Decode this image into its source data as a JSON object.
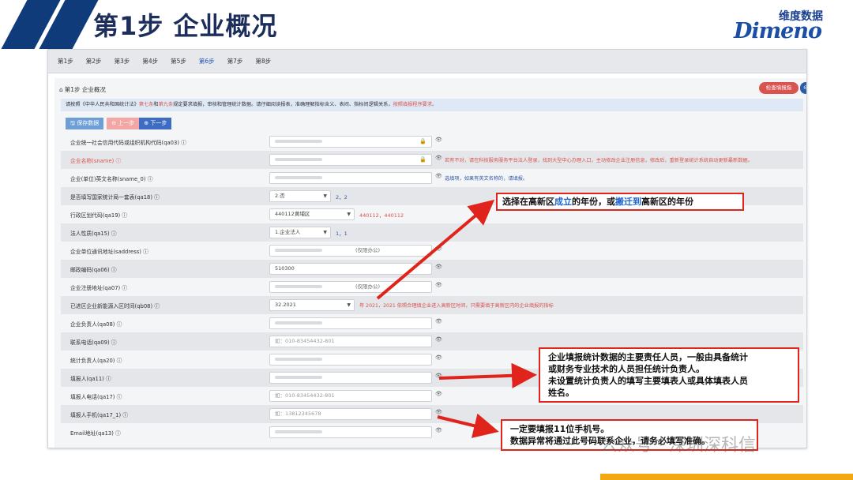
{
  "slide": {
    "title": "第1步  企业概况"
  },
  "logo": {
    "cn": "维度数据",
    "en": "Dimeno"
  },
  "steps": [
    "第1步",
    "第2步",
    "第3步",
    "第4步",
    "第5步",
    "第6步",
    "第7步",
    "第8步"
  ],
  "card": {
    "title": "第1步 企业概况",
    "check_button": "检查填报指",
    "more_button": "⊖",
    "notice_parts": [
      {
        "text": "请按照《中华人民共和国统计法》",
        "red": false
      },
      {
        "text": "第七条",
        "red": true
      },
      {
        "text": "和",
        "red": false
      },
      {
        "text": "第九条",
        "red": true
      },
      {
        "text": "规定要求填报，审核和管理统计数据。请仔细阅读报表，准确理解指标含义、表间、指标间逻辑关系，",
        "red": false
      },
      {
        "text": "按照填报程序要求。",
        "red": true
      }
    ],
    "save_button": "保存数据",
    "prev_button": "上一步",
    "next_button": "下一步"
  },
  "rows": [
    {
      "label": "企业统一社会信用代码或组织机构代码(qa03)",
      "value": "",
      "placeholder": "",
      "lock": true
    },
    {
      "label": "企业名称(sname)",
      "label_red": true,
      "value": "",
      "placeholder": "",
      "lock": true,
      "note": "若有不对，请在科技服务服务平台法人登录，找到大型中心办理入口，主动修改企业注册信息，修改后，重新登录统计系统自动更新最新数据。"
    },
    {
      "label": "企业(单位)英文名称(sname_0)",
      "value": "",
      "placeholder": "",
      "note": "选填项，如果有英文名称的，请填报。",
      "note_blue": true
    },
    {
      "label": "是否填写国家统计局一套表(qa18)",
      "value": "2.否",
      "select": true,
      "after": "2，2"
    },
    {
      "label": "行政区划代码(qa19)",
      "value": "440112黄埔区",
      "select": true,
      "val_note": "440112，440112"
    },
    {
      "label": "法人性质(qa15)",
      "value": "1.企业法人",
      "select": true,
      "after": "1，1"
    },
    {
      "label": "企业单位通讯地址(saddress)",
      "value": "",
      "placeholder": "",
      "suffix": "(仅限办公)"
    },
    {
      "label": "邮政编码(qa06)",
      "value": "510300",
      "placeholder": ""
    },
    {
      "label": "企业注册地址(qa07)",
      "value": "",
      "placeholder": "",
      "suffix": "(仅限办公)"
    },
    {
      "label": "已进区企业新能源入区时间(qb08)",
      "value": "32.2021",
      "select": true,
      "note": "年 2021，2021 依照合理填企业进入高新区时间，只需要填于高新区内的企业填报的指标"
    },
    {
      "label": "企业负责人(qa08)",
      "value": "",
      "placeholder": ""
    },
    {
      "label": "联系电话(qa09)",
      "value": "",
      "placeholder": "如：010-83454432-801"
    },
    {
      "label": "统计负责人(qa20)",
      "value": "",
      "placeholder": ""
    },
    {
      "label": "填报人(qa11)",
      "value": "",
      "placeholder": ""
    },
    {
      "label": "填报人电话(qa17)",
      "value": "",
      "placeholder": "如：010-83454432-801"
    },
    {
      "label": "填报人手机(qa17_1)",
      "value": "",
      "placeholder": "如：13812345678"
    },
    {
      "label": "Email地址(qa13)",
      "value": "",
      "placeholder": ""
    }
  ],
  "callouts": {
    "year": {
      "pre": "选择在高新区",
      "hl1": "成立",
      "mid": "的年份，或",
      "hl2": "搬迁到",
      "post": "高新区的年份"
    },
    "stat": [
      "企业填报统计数据的主要责任人员，一般由具备统计",
      "或财务专业技术的人员担任统计负责人。",
      "未设置统计负责人的填写主要填表人或具体填表人员",
      "姓名。"
    ],
    "phone": [
      "一定要填报11位手机号。",
      "数据异常将通过此号码联系企业，请务必填写准确。"
    ]
  },
  "watermark": "公众号 · 深圳深科信",
  "colors": {
    "header_navy": "#1d2e5b",
    "callout_red": "#e0241b",
    "accent_blue": "#1b63d1",
    "bottom_orange": "#f3a712"
  }
}
